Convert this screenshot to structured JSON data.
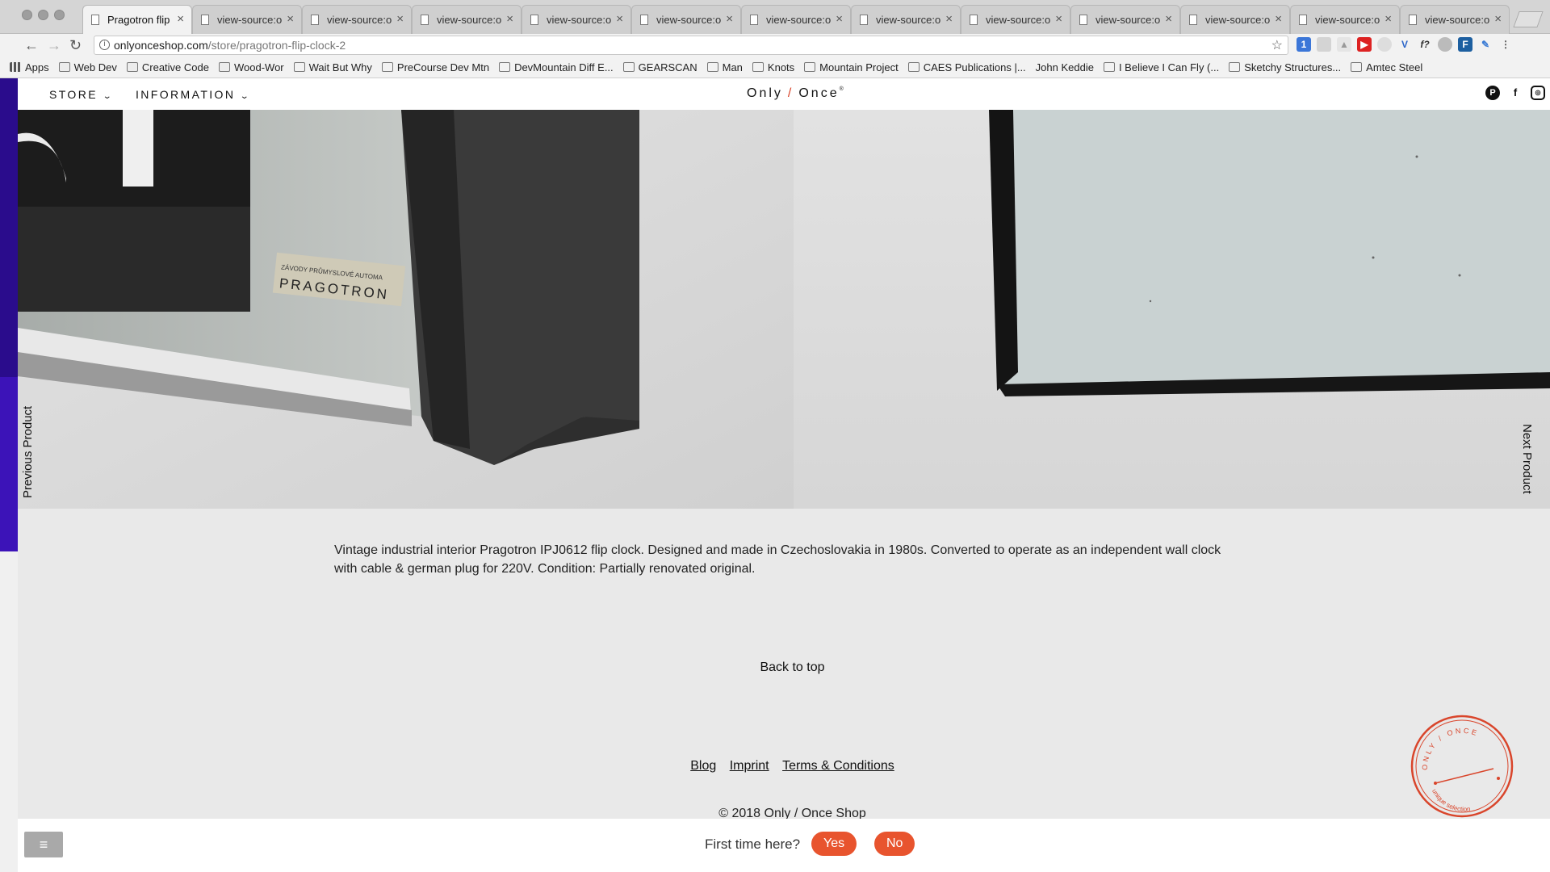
{
  "browser": {
    "tabs": [
      {
        "label": "Pragotron flip",
        "active": true
      },
      {
        "label": "view-source:o",
        "active": false
      },
      {
        "label": "view-source:o",
        "active": false
      },
      {
        "label": "view-source:o",
        "active": false
      },
      {
        "label": "view-source:o",
        "active": false
      },
      {
        "label": "view-source:o",
        "active": false
      },
      {
        "label": "view-source:o",
        "active": false
      },
      {
        "label": "view-source:o",
        "active": false
      },
      {
        "label": "view-source:o",
        "active": false
      },
      {
        "label": "view-source:o",
        "active": false
      },
      {
        "label": "view-source:o",
        "active": false
      },
      {
        "label": "view-source:o",
        "active": false
      },
      {
        "label": "view-source:o",
        "active": false
      }
    ],
    "url_host": "onlyonceshop.com",
    "url_path": "/store/pragotron-flip-clock-2",
    "bookmarks": [
      {
        "label": "Apps",
        "icon": "apps-icon"
      },
      {
        "label": "Web Dev",
        "icon": "folder-icon"
      },
      {
        "label": "Creative Code",
        "icon": "folder-icon"
      },
      {
        "label": "Wood-Wor",
        "icon": "folder-icon"
      },
      {
        "label": "Wait But Why",
        "icon": "page-icon"
      },
      {
        "label": "PreCourse Dev Mtn",
        "icon": "page-icon"
      },
      {
        "label": "DevMountain Diff E...",
        "icon": "page-icon"
      },
      {
        "label": "GEARSCAN",
        "icon": "page-icon"
      },
      {
        "label": "Man",
        "icon": "page-icon"
      },
      {
        "label": "Knots",
        "icon": "page-icon"
      },
      {
        "label": "Mountain Project",
        "icon": "page-icon"
      },
      {
        "label": "CAES Publications |...",
        "icon": "page-icon"
      },
      {
        "label": "John Keddie",
        "icon": "none"
      },
      {
        "label": "I Believe I Can Fly (...",
        "icon": "page-icon"
      },
      {
        "label": "Sketchy Structures...",
        "icon": "page-icon"
      },
      {
        "label": "Amtec Steel",
        "icon": "page-icon"
      }
    ]
  },
  "site": {
    "nav": {
      "store": "STORE",
      "information": "INFORMATION"
    },
    "logo": {
      "left": "Only",
      "slash": "/",
      "right": "Once",
      "mark": "®"
    },
    "social": {
      "pinterest": "P",
      "facebook": "f",
      "instagram": "◎"
    },
    "previous_product": "Previous Product",
    "next_product": "Next Product",
    "label_brand": "PRAGOTRON",
    "label_maker": "ZÁVODY PRŮMYSLOVÉ AUTOMA",
    "description": "Vintage industrial interior Pragotron IPJ0612 flip clock. Designed and made in Czechoslovakia in 1980s. Converted to operate as an independent wall clock with cable & german plug for 220V. Condition: Partially renovated original.",
    "back_to_top": "Back to top",
    "footer_links": [
      "Blog",
      "Imprint",
      "Terms & Conditions"
    ],
    "copyright": "© 2018 Only / Once Shop",
    "stamp": {
      "top": "ONLY / ONCE",
      "bottom": "unique selection"
    }
  },
  "bottom_bar": {
    "first_time": "First time here?",
    "yes": "Yes",
    "no": "No"
  },
  "colors": {
    "accent": "#e8542e",
    "stamp": "#d9452b"
  }
}
